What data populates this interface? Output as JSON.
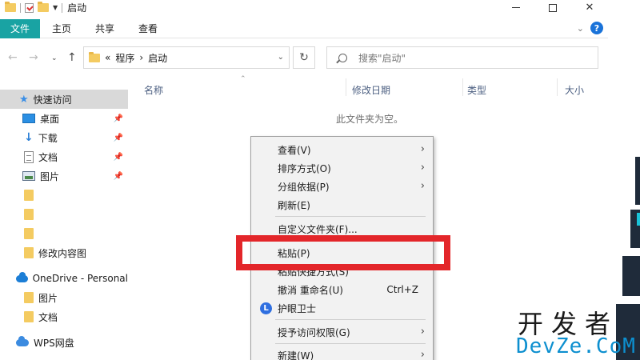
{
  "window": {
    "title": "启动"
  },
  "ribbon": {
    "tabs": [
      {
        "label": "文件"
      },
      {
        "label": "主页"
      },
      {
        "label": "共享"
      },
      {
        "label": "查看"
      }
    ],
    "help_label": "?"
  },
  "address": {
    "prefix": "«",
    "crumbs": [
      "程序",
      "启动"
    ],
    "separator": "›"
  },
  "search": {
    "placeholder": "搜索\"启动\""
  },
  "sidebar": {
    "items": [
      {
        "label": "快速访问"
      },
      {
        "label": "桌面"
      },
      {
        "label": "下载"
      },
      {
        "label": "文档"
      },
      {
        "label": "图片"
      },
      {
        "label": ""
      },
      {
        "label": ""
      },
      {
        "label": ""
      },
      {
        "label": "修改内容图"
      },
      {
        "label": "OneDrive - Personal"
      },
      {
        "label": "图片"
      },
      {
        "label": "文档"
      },
      {
        "label": "WPS网盘"
      }
    ]
  },
  "columns": {
    "name": "名称",
    "modified": "修改日期",
    "type": "类型",
    "size": "大小"
  },
  "content": {
    "empty_message": "此文件夹为空。"
  },
  "context_menu": {
    "items": [
      {
        "label": "查看(V)"
      },
      {
        "label": "排序方式(O)"
      },
      {
        "label": "分组依据(P)"
      },
      {
        "label": "刷新(E)"
      },
      {
        "label": "自定义文件夹(F)..."
      },
      {
        "label": "粘贴(P)"
      },
      {
        "label": "粘贴快捷方式(S)"
      },
      {
        "label": "撤消 重命名(U)",
        "shortcut": "Ctrl+Z"
      },
      {
        "label": "护眼卫士",
        "icon_label": "L"
      },
      {
        "label": "授予访问权限(G)"
      },
      {
        "label": "新建(W)"
      }
    ]
  },
  "watermark": {
    "line1": "开发者",
    "line2": "DevZe.CoM"
  },
  "colors": {
    "accent": "#19a3a3",
    "highlight": "#e3262a"
  }
}
